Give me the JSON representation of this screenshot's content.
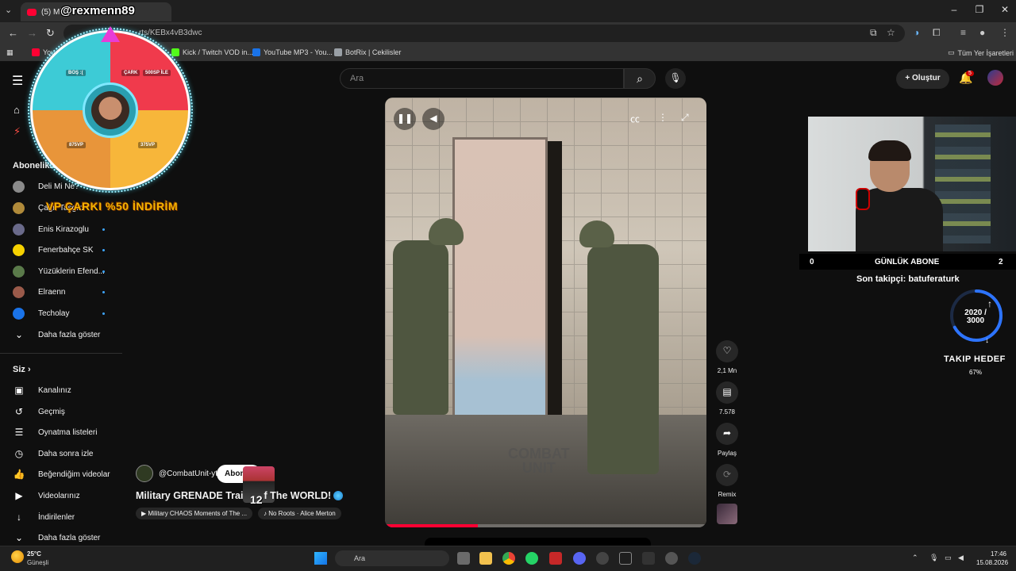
{
  "watermark": "@rexmenn89",
  "browser": {
    "tab_title": "(5) Milit",
    "address_fragment": "rts/KEBx4vB3dwc",
    "bookmarks": [
      {
        "label": "You",
        "color": "#ff0033"
      },
      {
        "label": "Kick / Twitch VOD in...",
        "color": "#53fc18"
      },
      {
        "label": "YouTube MP3 - You...",
        "color": "#1a73e8"
      },
      {
        "label": "BotRix | Cekilisler",
        "color": "#9aa0a6"
      }
    ],
    "all_bookmarks": "Tüm Yer İşaretleri"
  },
  "header": {
    "search_placeholder": "Ara",
    "create_label": "Oluştur",
    "notification_count": "5"
  },
  "sidebar": {
    "subscriptions_title": "Abonelikler",
    "subscriptions": [
      {
        "name": "Deli Mi Ne?",
        "color": "#8a8a8a",
        "dot": false
      },
      {
        "name": "Çağrı Taşgın",
        "color": "#b08a3a",
        "dot": false
      },
      {
        "name": "Enis Kirazoglu",
        "color": "#6a6a8a",
        "dot": true
      },
      {
        "name": "Fenerbahçe SK",
        "color": "#f5d100",
        "dot": true
      },
      {
        "name": "Yüzüklerin Efend...",
        "color": "#5a7a4a",
        "dot": true
      },
      {
        "name": "Elraenn",
        "color": "#9a5a4a",
        "dot": true
      },
      {
        "name": "Techolay",
        "color": "#1a73e8",
        "dot": true
      }
    ],
    "show_more": "Daha fazla göster",
    "you_title": "Siz",
    "you_items": [
      "Kanalınız",
      "Geçmiş",
      "Oynatma listeleri",
      "Daha sonra izle",
      "Beğendiğim videolar",
      "Videolarınız",
      "İndirilenler",
      "Daha fazla göster"
    ]
  },
  "wheel": {
    "labels": [
      "BOŞ :(",
      "ÇARK",
      "500SP İLE",
      "875VP",
      "375VP"
    ],
    "promo": "VP ÇARKI %50 İNDİRİM"
  },
  "video": {
    "watermark_line1": "COMBAT",
    "watermark_line2": "UNIT",
    "progress": 0.29,
    "channel": "@CombatUnit-yt",
    "subscribe_label": "Abone ol",
    "emote_count": "12",
    "title_part1": "Military GRENADE Trai",
    "title_part2": "f The WORLD!",
    "playlist_pill": "Military CHAOS Moments of The ...",
    "sound_pill": "No Roots · Alice Merton"
  },
  "actions": {
    "likes": "2,1 Mn",
    "comments": "7.578",
    "share": "Paylaş",
    "remix": "Remix"
  },
  "stream": {
    "goal_left": "0",
    "goal_title": "GÜNLÜK ABONE",
    "goal_right": "2",
    "last_follower": "Son takipçi: batuferaturk",
    "follow_progress": "2020 / 3000",
    "follow_goal_title": "TAKIP HEDEF",
    "follow_goal_pct": "67%",
    "ring_fraction": 0.67
  },
  "taskbar": {
    "temp": "25°C",
    "weather": "Güneşli",
    "search": "Ara",
    "time": "17:46",
    "date": "15.08.2026"
  }
}
